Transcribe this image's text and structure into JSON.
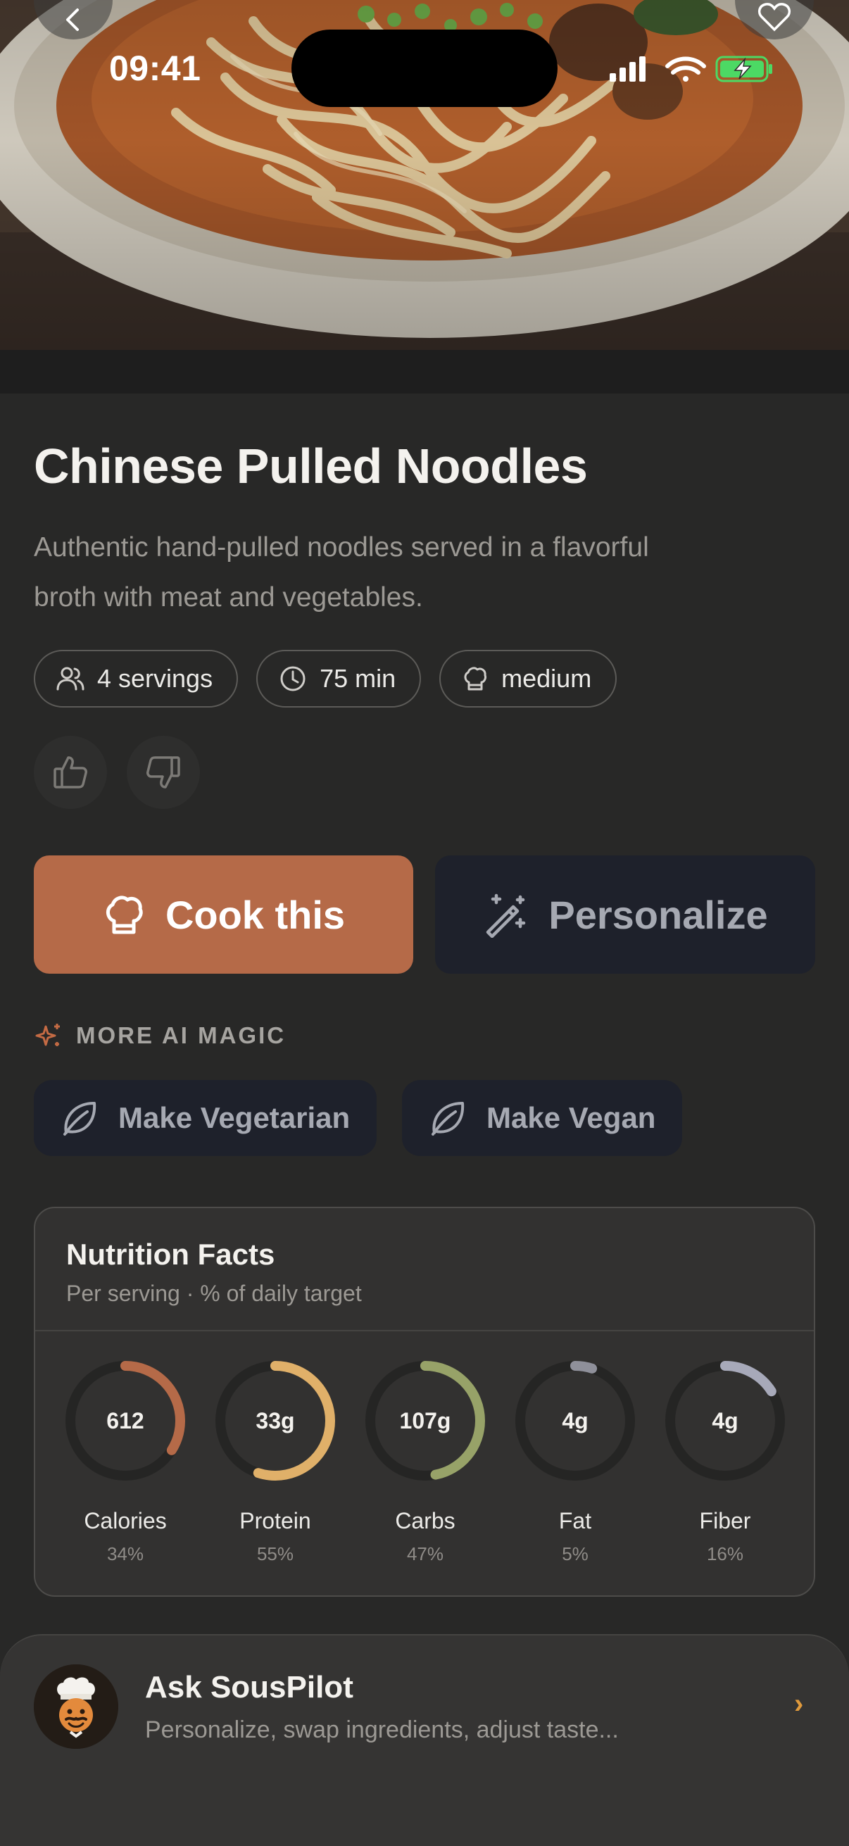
{
  "status_bar": {
    "time": "09:41"
  },
  "hero": {
    "image": "noodle-soup-photo"
  },
  "recipe": {
    "title": "Chinese Pulled Noodles",
    "description_line1": "Authentic hand-pulled noodles served in a flavorful",
    "description_line2": "broth with meat and vegetables.",
    "servings": "4 servings",
    "time": "75 min",
    "difficulty": "medium"
  },
  "actions": {
    "cook_label": "Cook this",
    "personalize_label": "Personalize"
  },
  "ai_magic": {
    "label": "MORE AI MAGIC",
    "chips": [
      "Make Vegetarian",
      "Make Vegan"
    ]
  },
  "nutrition": {
    "title": "Nutrition Facts",
    "subtitle": "Per serving · % of daily target",
    "items": [
      {
        "value": "612",
        "label": "Calories",
        "pct": "34%",
        "fraction": 0.34,
        "color": "#b56a48"
      },
      {
        "value": "33g",
        "label": "Protein",
        "pct": "55%",
        "fraction": 0.55,
        "color": "#e0b069"
      },
      {
        "value": "107g",
        "label": "Carbs",
        "pct": "47%",
        "fraction": 0.47,
        "color": "#97a268"
      },
      {
        "value": "4g",
        "label": "Fat",
        "pct": "5%",
        "fraction": 0.05,
        "color": "#8f909a"
      },
      {
        "value": "4g",
        "label": "Fiber",
        "pct": "16%",
        "fraction": 0.16,
        "color": "#a7a9b9"
      }
    ]
  },
  "assistant": {
    "title": "Ask SousPilot",
    "subtitle": "Personalize, swap ingredients, adjust taste...",
    "chevron": "›"
  },
  "colors": {
    "accent": "#b56a48",
    "secondary_button": "#1e212b",
    "background": "#282827"
  }
}
